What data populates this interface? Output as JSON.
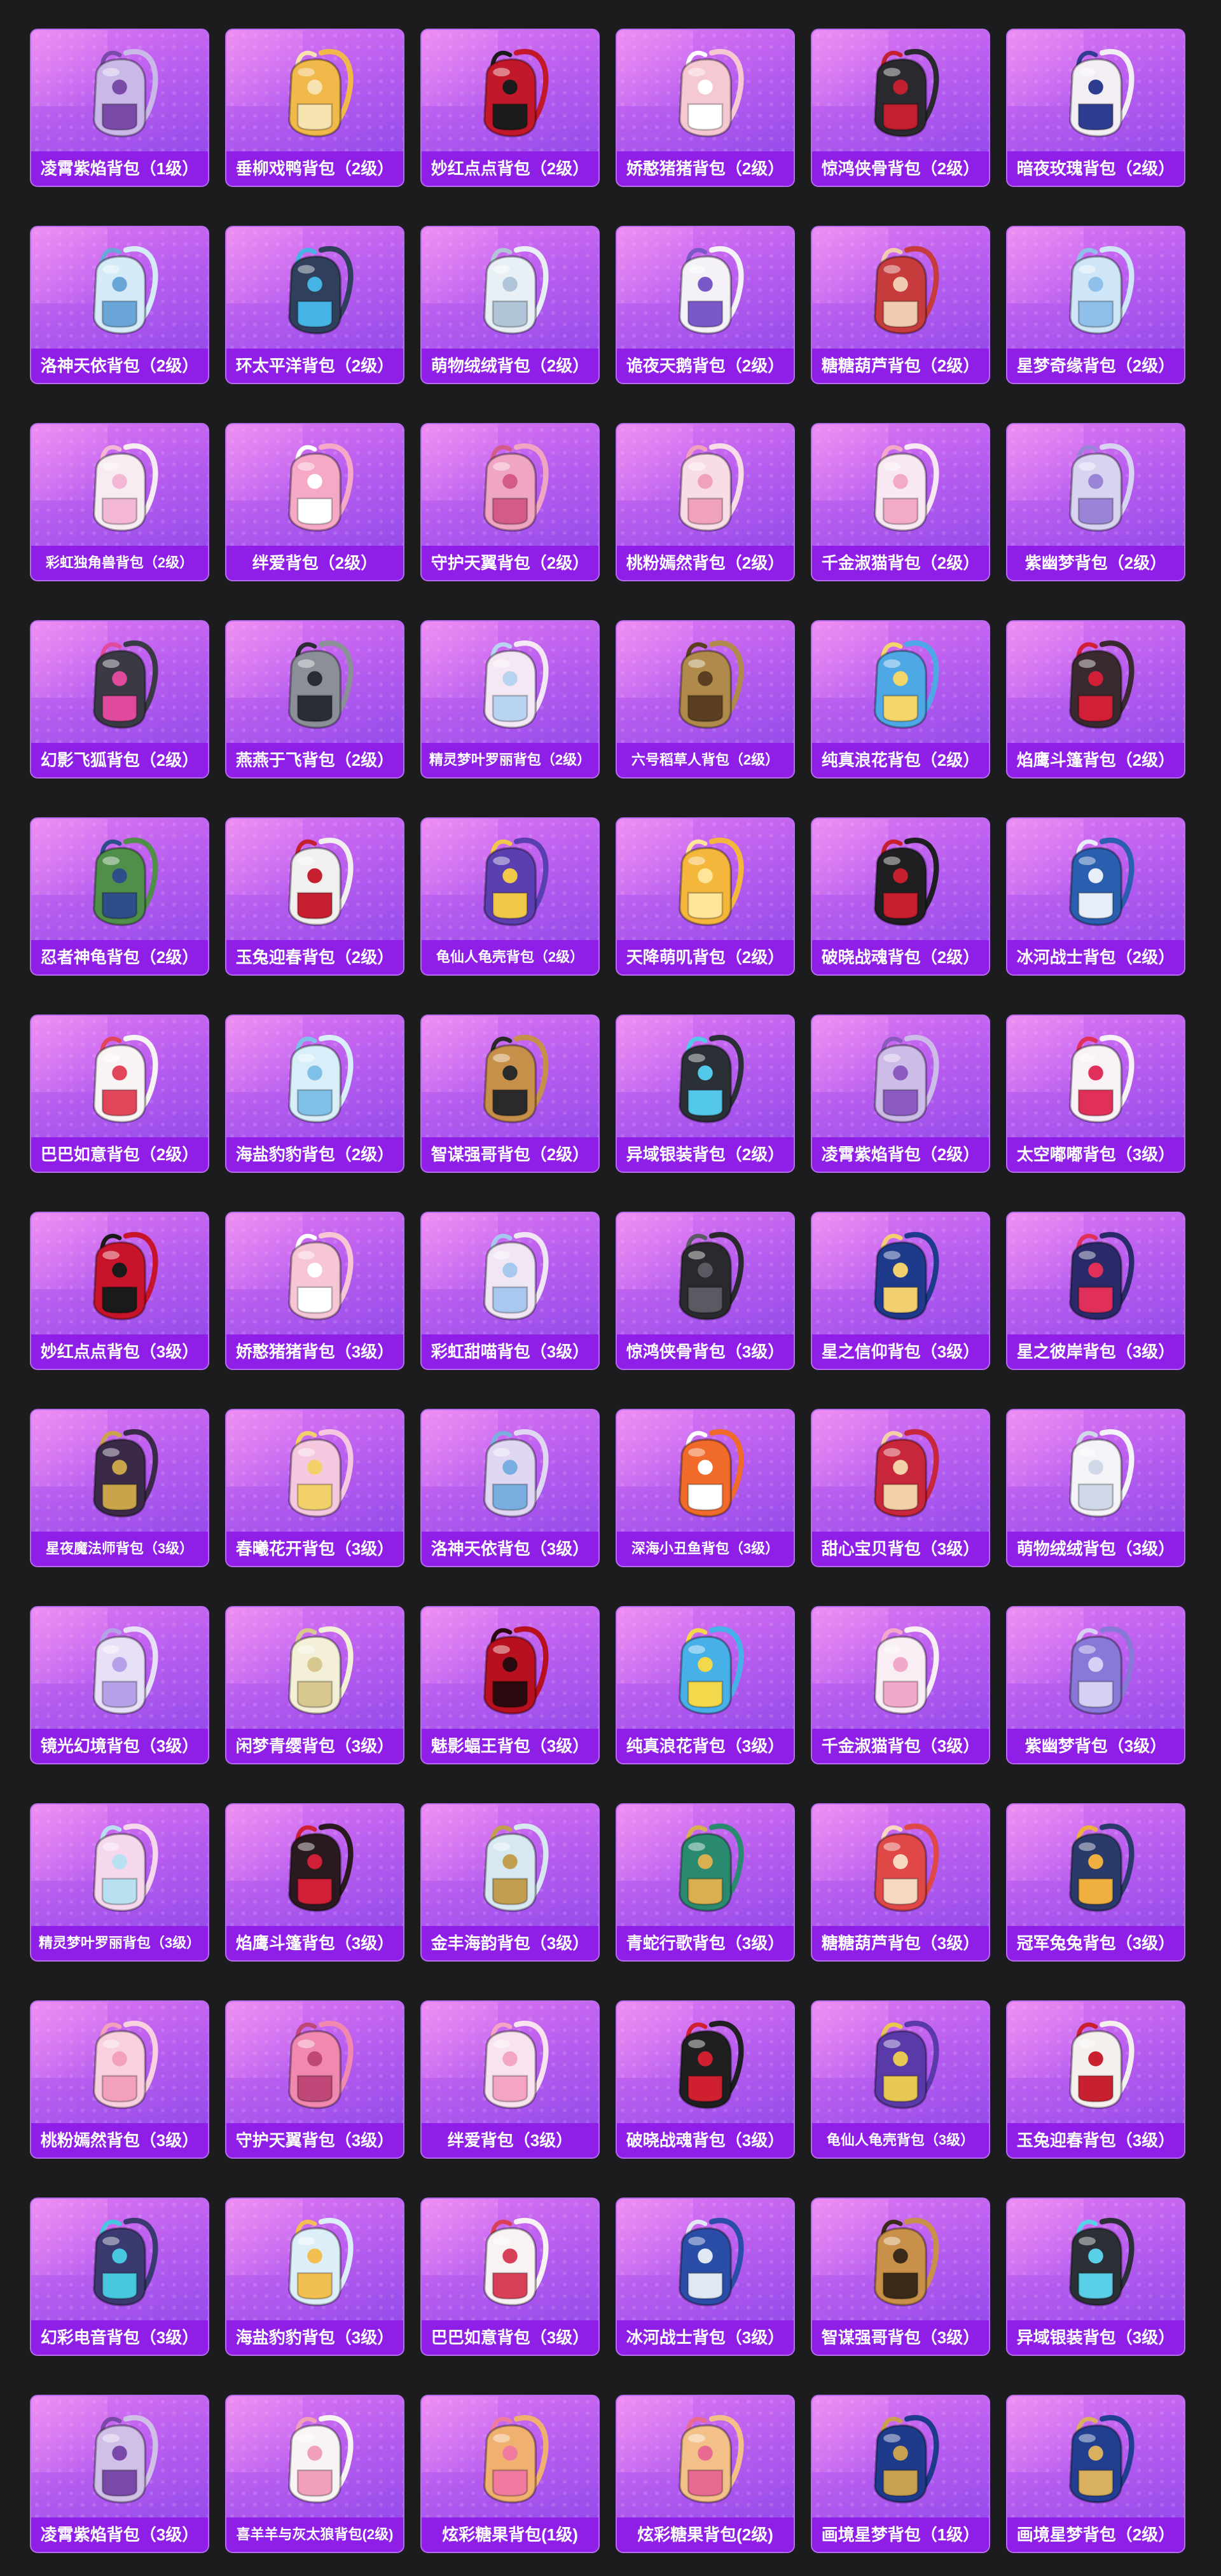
{
  "items": [
    {
      "name": "凌霄紫焰背包（1级）",
      "color": "#c9b8e8",
      "accent": "#7a4aa8",
      "icon": "backpack-icon"
    },
    {
      "name": "垂柳戏鸭背包（2级）",
      "color": "#f0b94a",
      "accent": "#f7e3b0",
      "icon": "backpack-icon"
    },
    {
      "name": "妙红点点背包（2级）",
      "color": "#c3182a",
      "accent": "#1b1b1b",
      "icon": "backpack-icon"
    },
    {
      "name": "娇憨猪猪背包（2级）",
      "color": "#f6c8d2",
      "accent": "#ffffff",
      "icon": "backpack-icon"
    },
    {
      "name": "惊鸿侠骨背包（2级）",
      "color": "#2a2a2e",
      "accent": "#c21f2f",
      "icon": "backpack-icon"
    },
    {
      "name": "暗夜玫瑰背包（2级）",
      "color": "#f2eef4",
      "accent": "#2e3d8f",
      "icon": "backpack-icon"
    },
    {
      "name": "洛神天依背包（2级）",
      "color": "#d5ecf8",
      "accent": "#6aa5d8",
      "icon": "backpack-icon"
    },
    {
      "name": "环太平洋背包（2级）",
      "color": "#2f3f5c",
      "accent": "#46b5e6",
      "icon": "backpack-icon"
    },
    {
      "name": "萌物绒绒背包（2级）",
      "color": "#e8f0f6",
      "accent": "#b0c6d8",
      "icon": "backpack-icon"
    },
    {
      "name": "诡夜天鹅背包（2级）",
      "color": "#f4f2f6",
      "accent": "#7a58c8",
      "icon": "backpack-icon"
    },
    {
      "name": "糖糖葫芦背包（2级）",
      "color": "#c63b3b",
      "accent": "#f1cbb0",
      "icon": "backpack-icon"
    },
    {
      "name": "星梦奇缘背包（2级）",
      "color": "#cfe6f8",
      "accent": "#8fc0ea",
      "icon": "backpack-icon"
    },
    {
      "name": "彩虹独角兽背包（2级）",
      "color": "#f6ecf2",
      "accent": "#f3b6d4",
      "icon": "backpack-icon"
    },
    {
      "name": "绊爱背包（2级）",
      "color": "#f5a9c6",
      "accent": "#ffffff",
      "icon": "backpack-icon"
    },
    {
      "name": "守护天翼背包（2级）",
      "color": "#f0a5c2",
      "accent": "#d45a8a",
      "icon": "backpack-icon"
    },
    {
      "name": "桃粉嫣然背包（2级）",
      "color": "#f8dde6",
      "accent": "#f0a1bd",
      "icon": "backpack-icon"
    },
    {
      "name": "千金淑猫背包（2级）",
      "color": "#f8e8f2",
      "accent": "#f3a9c8",
      "icon": "backpack-icon"
    },
    {
      "name": "紫幽梦背包（2级）",
      "color": "#d9d3f2",
      "accent": "#9a84d8",
      "icon": "backpack-icon"
    },
    {
      "name": "幻影飞狐背包（2级）",
      "color": "#3a3a44",
      "accent": "#e04a9c",
      "icon": "backpack-icon"
    },
    {
      "name": "燕燕于飞背包（2级）",
      "color": "#8a8f98",
      "accent": "#2a2d33",
      "icon": "backpack-icon"
    },
    {
      "name": "精灵梦叶罗丽背包（2级）",
      "color": "#f4e8f4",
      "accent": "#b9d4f0",
      "icon": "backpack-icon"
    },
    {
      "name": "六号稻草人背包（2级）",
      "color": "#b08a4a",
      "accent": "#5a4020",
      "icon": "backpack-icon"
    },
    {
      "name": "纯真浪花背包（2级）",
      "color": "#4fa8e6",
      "accent": "#f2d66a",
      "icon": "backpack-icon"
    },
    {
      "name": "焰鹰斗篷背包（2级）",
      "color": "#3a2a30",
      "accent": "#d01f36",
      "icon": "backpack-icon"
    },
    {
      "name": "忍者神龟背包（2级）",
      "color": "#4f8f4a",
      "accent": "#2e4e8a",
      "icon": "backpack-icon"
    },
    {
      "name": "玉兔迎春背包（2级）",
      "color": "#f2f0ee",
      "accent": "#c61f2f",
      "icon": "backpack-icon"
    },
    {
      "name": "龟仙人龟壳背包（2级）",
      "color": "#5a3fb0",
      "accent": "#f0c84a",
      "icon": "backpack-icon"
    },
    {
      "name": "天降萌叽背包（2级）",
      "color": "#f4b73c",
      "accent": "#ffe59a",
      "icon": "backpack-icon"
    },
    {
      "name": "破晓战魂背包（2级）",
      "color": "#1f1f22",
      "accent": "#c81f2e",
      "icon": "backpack-icon"
    },
    {
      "name": "冰河战士背包（2级）",
      "color": "#2a5fb0",
      "accent": "#e8eef8",
      "icon": "backpack-icon"
    },
    {
      "name": "巴巴如意背包（2级）",
      "color": "#f8f4f4",
      "accent": "#e0455a",
      "icon": "backpack-icon"
    },
    {
      "name": "海盐豹豹背包（2级）",
      "color": "#d8eef8",
      "accent": "#7fc0e8",
      "icon": "backpack-icon"
    },
    {
      "name": "智谋强哥背包（2级）",
      "color": "#c6904a",
      "accent": "#2a2a2a",
      "icon": "backpack-icon"
    },
    {
      "name": "异域银装背包（2级）",
      "color": "#2b2f36",
      "accent": "#54c8e8",
      "icon": "backpack-icon"
    },
    {
      "name": "凌霄紫焰背包（2级）",
      "color": "#cdbbe8",
      "accent": "#8a5ac0",
      "icon": "backpack-icon"
    },
    {
      "name": "太空嘟嘟背包（3级）",
      "color": "#f8f2f6",
      "accent": "#e0305a",
      "icon": "backpack-icon"
    },
    {
      "name": "妙红点点背包（3级）",
      "color": "#c8142a",
      "accent": "#1a1a1a",
      "icon": "backpack-icon"
    },
    {
      "name": "娇憨猪猪背包（3级）",
      "color": "#f6c6d4",
      "accent": "#ffffff",
      "icon": "backpack-icon"
    },
    {
      "name": "彩虹甜喵背包（3级）",
      "color": "#f0e6f4",
      "accent": "#a8c8f0",
      "icon": "backpack-icon"
    },
    {
      "name": "惊鸿侠骨背包（3级）",
      "color": "#2a2a2e",
      "accent": "#5a5a62",
      "icon": "backpack-icon"
    },
    {
      "name": "星之信仰背包（3级）",
      "color": "#1e3a8a",
      "accent": "#f2d070",
      "icon": "backpack-icon"
    },
    {
      "name": "星之彼岸背包（3级）",
      "color": "#2a2a6a",
      "accent": "#e0305a",
      "icon": "backpack-icon"
    },
    {
      "name": "星夜魔法师背包（3级）",
      "color": "#3a2a48",
      "accent": "#c9a44a",
      "icon": "backpack-icon"
    },
    {
      "name": "春曦花开背包（3级）",
      "color": "#f6c8e0",
      "accent": "#f2d06a",
      "icon": "backpack-icon"
    },
    {
      "name": "洛神天依背包（3级）",
      "color": "#e0d8f2",
      "accent": "#7aaee0",
      "icon": "backpack-icon"
    },
    {
      "name": "深海小丑鱼背包（3级）",
      "color": "#f06a2a",
      "accent": "#ffffff",
      "icon": "backpack-icon"
    },
    {
      "name": "甜心宝贝背包（3级）",
      "color": "#c8263a",
      "accent": "#f4d0a8",
      "icon": "backpack-icon"
    },
    {
      "name": "萌物绒绒背包（3级）",
      "color": "#f4f4f8",
      "accent": "#d0d8e8",
      "icon": "backpack-icon"
    },
    {
      "name": "镜光幻境背包（3级）",
      "color": "#e8e0f6",
      "accent": "#b6a0e8",
      "icon": "backpack-icon"
    },
    {
      "name": "闲梦青缨背包（3级）",
      "color": "#f4f0d8",
      "accent": "#d8c890",
      "icon": "backpack-icon"
    },
    {
      "name": "魅影蝠王背包（3级）",
      "color": "#b8101e",
      "accent": "#2a0a0e",
      "icon": "backpack-icon"
    },
    {
      "name": "纯真浪花背包（3级）",
      "color": "#48b0e8",
      "accent": "#f2d84a",
      "icon": "backpack-icon"
    },
    {
      "name": "千金淑猫背包（3级）",
      "color": "#f8eef4",
      "accent": "#f2a8c8",
      "icon": "backpack-icon"
    },
    {
      "name": "紫幽梦背包（3级）",
      "color": "#8a78d8",
      "accent": "#d8d0f4",
      "icon": "backpack-icon"
    },
    {
      "name": "精灵梦叶罗丽背包（3级）",
      "color": "#f6d8ec",
      "accent": "#b8e0f0",
      "icon": "backpack-icon"
    },
    {
      "name": "焰鹰斗篷背包（3级）",
      "color": "#2a1a20",
      "accent": "#d01f36",
      "icon": "backpack-icon"
    },
    {
      "name": "金丰海韵背包（3级）",
      "color": "#d8e8f0",
      "accent": "#c0a050",
      "icon": "backpack-icon"
    },
    {
      "name": "青蛇行歌背包（3级）",
      "color": "#2a8a70",
      "accent": "#d8b050",
      "icon": "backpack-icon"
    },
    {
      "name": "糖糖葫芦背包（3级）",
      "color": "#e04848",
      "accent": "#f6d8c0",
      "icon": "backpack-icon"
    },
    {
      "name": "冠军兔兔背包（3级）",
      "color": "#2a3a6a",
      "accent": "#f0b040",
      "icon": "backpack-icon"
    },
    {
      "name": "桃粉嫣然背包（3级）",
      "color": "#f8d0de",
      "accent": "#f2a0bc",
      "icon": "backpack-icon"
    },
    {
      "name": "守护天翼背包（3级）",
      "color": "#f088b0",
      "accent": "#c04878",
      "icon": "backpack-icon"
    },
    {
      "name": "绊爱背包（3级）",
      "color": "#f8e4ee",
      "accent": "#f4a4c4",
      "icon": "backpack-icon"
    },
    {
      "name": "破晓战魂背包（3级）",
      "color": "#1f1f22",
      "accent": "#d02030",
      "icon": "backpack-icon"
    },
    {
      "name": "龟仙人龟壳背包（3级）",
      "color": "#5a3aa8",
      "accent": "#e8c850",
      "icon": "backpack-icon"
    },
    {
      "name": "玉兔迎春背包（3级）",
      "color": "#f4f0ee",
      "accent": "#c8202e",
      "icon": "backpack-icon"
    },
    {
      "name": "幻彩电音背包（3级）",
      "color": "#3a3a70",
      "accent": "#48c8e0",
      "icon": "backpack-icon"
    },
    {
      "name": "海盐豹豹背包（3级）",
      "color": "#dceef8",
      "accent": "#f2c050",
      "icon": "backpack-icon"
    },
    {
      "name": "巴巴如意背包（3级）",
      "color": "#f8f2f2",
      "accent": "#d84058",
      "icon": "backpack-icon"
    },
    {
      "name": "冰河战士背包（3级）",
      "color": "#2a4ea8",
      "accent": "#e0e8f4",
      "icon": "backpack-icon"
    },
    {
      "name": "智谋强哥背包（3级）",
      "color": "#c89048",
      "accent": "#3a2a1a",
      "icon": "backpack-icon"
    },
    {
      "name": "异域银装背包（3级）",
      "color": "#2a3036",
      "accent": "#5ad0e8",
      "icon": "backpack-icon"
    },
    {
      "name": "凌霄紫焰背包（3级）",
      "color": "#d0c0e8",
      "accent": "#7a48a8",
      "icon": "backpack-icon"
    },
    {
      "name": "喜羊羊与灰太狼背包(2级)",
      "color": "#f8f4f4",
      "accent": "#f0a0b8",
      "icon": "backpack-icon"
    },
    {
      "name": "炫彩糖果背包(1级)",
      "color": "#f0b070",
      "accent": "#f07aa0",
      "icon": "backpack-icon"
    },
    {
      "name": "炫彩糖果背包(2级)",
      "color": "#f2c088",
      "accent": "#e86a90",
      "icon": "backpack-icon"
    },
    {
      "name": "画境星梦背包（1级）",
      "color": "#1e3a8a",
      "accent": "#c8a050",
      "icon": "backpack-icon"
    },
    {
      "name": "画境星梦背包（2级）",
      "color": "#223e90",
      "accent": "#d8b060",
      "icon": "backpack-icon"
    }
  ]
}
